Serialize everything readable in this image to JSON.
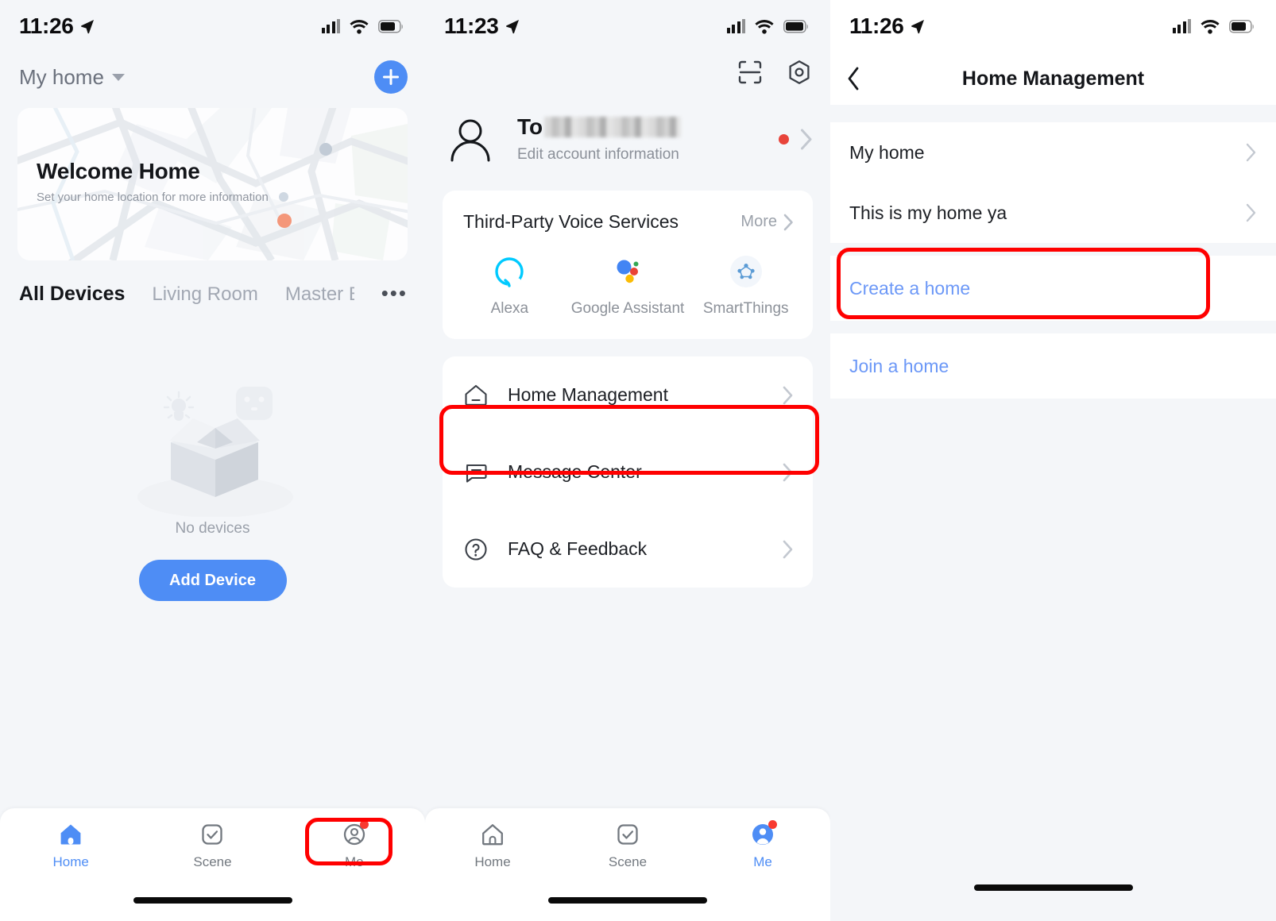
{
  "panels": {
    "home": {
      "status": {
        "time": "11:26"
      },
      "home_selector": "My home",
      "add_button": "add-button",
      "map_card": {
        "title": "Welcome Home",
        "subtitle": "Set your home location for more information"
      },
      "room_tabs": [
        {
          "label": "All Devices",
          "active": true
        },
        {
          "label": "Living Room",
          "active": false
        },
        {
          "label": "Master Be",
          "active": false
        }
      ],
      "tabs_overflow": "•••",
      "empty_state": {
        "message": "No devices",
        "action": "Add Device"
      },
      "tabbar": [
        {
          "label": "Home",
          "icon": "home-icon",
          "active": true,
          "badge": false
        },
        {
          "label": "Scene",
          "icon": "scene-icon",
          "active": false,
          "badge": false
        },
        {
          "label": "Me",
          "icon": "me-icon",
          "active": false,
          "badge": true
        }
      ]
    },
    "me": {
      "status": {
        "time": "11:23"
      },
      "top_icons": [
        "scan-icon",
        "settings-icon"
      ],
      "profile": {
        "name_prefix": "To",
        "name_redacted": true,
        "subtitle": "Edit account information",
        "has_notification_dot": true
      },
      "voice_services": {
        "title": "Third-Party Voice Services",
        "more_label": "More",
        "items": [
          {
            "label": "Alexa",
            "icon": "alexa-icon"
          },
          {
            "label": "Google Assistant",
            "icon": "google-assistant-icon"
          },
          {
            "label": "SmartThings",
            "icon": "smartthings-icon"
          }
        ]
      },
      "menu": [
        {
          "label": "Home Management",
          "icon": "house-outline-icon",
          "highlighted": true
        },
        {
          "label": "Message Center",
          "icon": "message-icon",
          "highlighted": false
        },
        {
          "label": "FAQ & Feedback",
          "icon": "question-circle-icon",
          "highlighted": false
        }
      ],
      "tabbar": [
        {
          "label": "Home",
          "icon": "home-icon",
          "active": false,
          "badge": false
        },
        {
          "label": "Scene",
          "icon": "scene-icon",
          "active": false,
          "badge": false
        },
        {
          "label": "Me",
          "icon": "me-icon",
          "active": true,
          "badge": true
        }
      ]
    },
    "home_management": {
      "status": {
        "time": "11:26"
      },
      "nav": {
        "back": "back-chevron-icon",
        "title": "Home Management"
      },
      "homes": [
        {
          "label": "My home"
        },
        {
          "label": "This is my home ya"
        }
      ],
      "actions": [
        {
          "label": "Create a home",
          "highlighted": true
        },
        {
          "label": "Join a home",
          "highlighted": false
        }
      ]
    }
  },
  "colors": {
    "accent": "#4e8df5",
    "link": "#6c98f7",
    "annotation": "#ff0000",
    "badge": "#f83a30",
    "page_bg": "#f4f6f9",
    "card_bg": "#ffffff"
  }
}
